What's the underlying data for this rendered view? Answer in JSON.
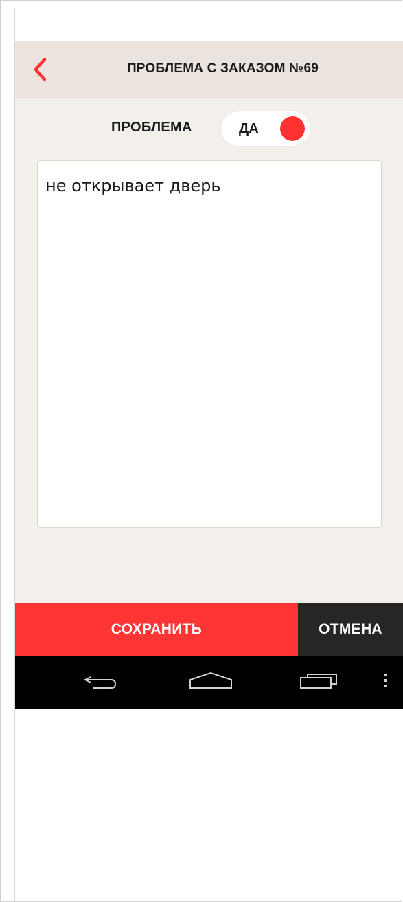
{
  "header": {
    "title": "ПРОБЛЕМА С ЗАКАЗОМ №69",
    "back_icon": "chevron-left-icon"
  },
  "problem": {
    "label": "ПРОБЛЕМА",
    "toggle_value": "ДА",
    "toggle_on": true
  },
  "description": {
    "value": "не открывает дверь"
  },
  "actions": {
    "save_label": "СОХРАНИТЬ",
    "cancel_label": "ОТМЕНА"
  },
  "system_nav": {
    "back_icon": "android-back-icon",
    "home_icon": "android-home-icon",
    "recents_icon": "android-recents-icon",
    "menu_icon": "overflow-menu-icon"
  },
  "colors": {
    "accent": "#ff3535",
    "header_bg": "#ebe4de",
    "screen_bg": "#f3efeb",
    "cancel_bg": "#262626",
    "nav_bg": "#000000"
  }
}
